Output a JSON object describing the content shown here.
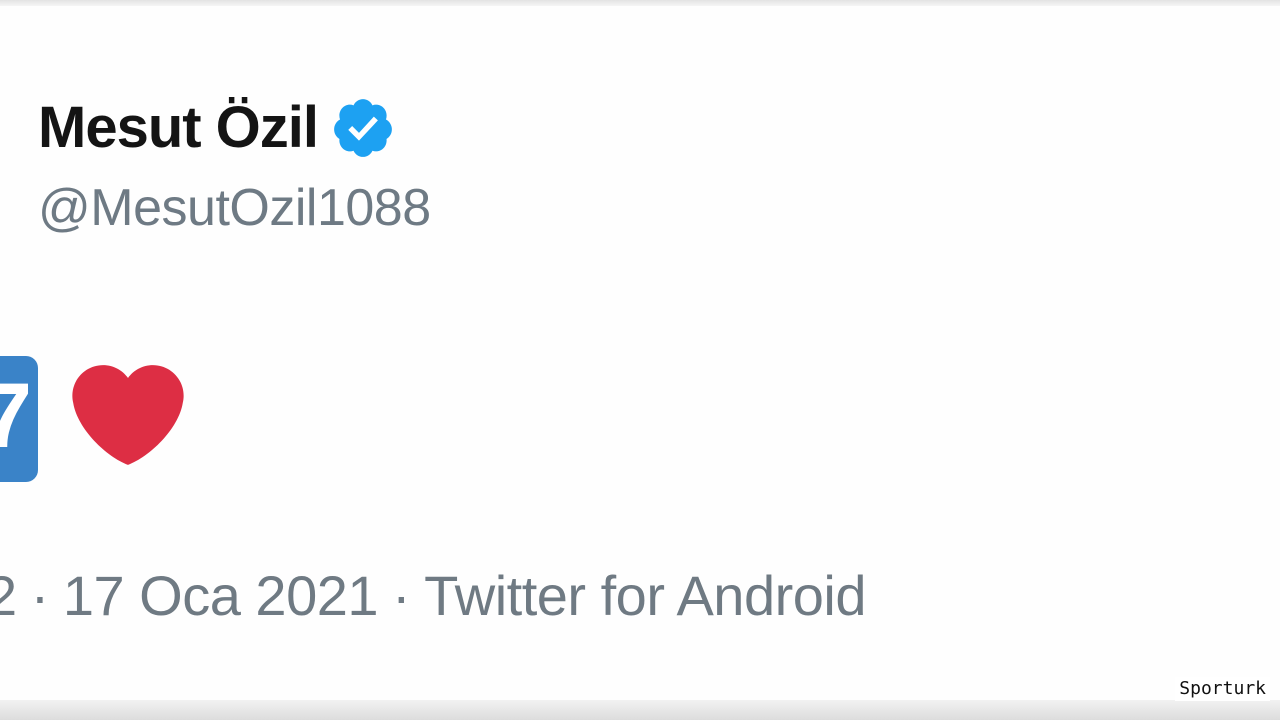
{
  "tweet": {
    "display_name": "Mesut Özil",
    "handle": "@MesutOzil1088",
    "verified": true,
    "content": {
      "number_emoji_visible_digit": "7",
      "heart_emoji": "red-heart"
    },
    "meta": {
      "time_fragment": "2",
      "separator": "·",
      "date": "17 Oca 2021",
      "source": "Twitter for Android"
    }
  },
  "watermark": {
    "text": "Sporturk"
  },
  "colors": {
    "verified_blue": "#1da1f2",
    "heart_red": "#dd2e44",
    "number_emoji_blue": "#3a83c8",
    "meta_gray": "#6f7a83",
    "name_black": "#141414"
  },
  "icons": {
    "verified": "verified-badge-icon",
    "heart": "heart-icon",
    "number": "keycap-number-emoji"
  }
}
